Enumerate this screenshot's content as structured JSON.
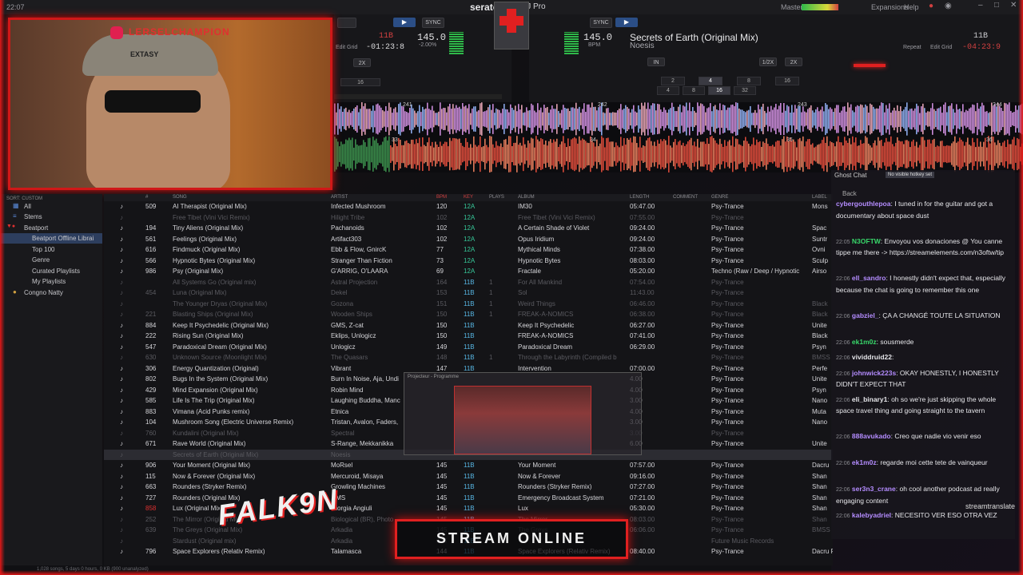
{
  "topbar": {
    "clock": "22:07",
    "app_name": "serato",
    "app_suffix": "DJ Pro",
    "master_label": "Master",
    "expansions": "Expansions",
    "help": "Help"
  },
  "deck_left": {
    "key": "11B",
    "bpm": "145.0",
    "pitch": "-2.00%",
    "time": "-01:23:8",
    "edit_grid": "Edit Grid",
    "sync": "SYNC",
    "pads_top": [
      "16"
    ],
    "pad_rows": [
      "2X"
    ]
  },
  "deck_right": {
    "title": "Secrets of Earth (Original Mix)",
    "artist": "Noesis",
    "bpm": "145.0",
    "bpm_label": "BPM",
    "key": "11B",
    "time": "-04:23:9",
    "repeat": "Repeat",
    "edit_grid": "Edit Grid",
    "sync": "SYNC",
    "loop_top": [
      "IN",
      "1/2X",
      "2X"
    ],
    "loop_row1": [
      "2",
      "4",
      "8",
      "16"
    ],
    "loop_row2": [
      "4",
      "8",
      "16",
      "32"
    ],
    "loop_right": "16"
  },
  "waveform": {
    "beat_markers": [
      "241",
      "242",
      "243",
      "244"
    ],
    "lower_markers": [
      "33",
      "34",
      "35",
      "36"
    ]
  },
  "webcam": {
    "ig_handle": "LERSELCHAMPION",
    "cap_text": "EXTASY"
  },
  "sidebar": {
    "header": "SORT: CUSTOM",
    "items": [
      {
        "label": "All"
      },
      {
        "label": "Stems"
      },
      {
        "label": "Beatport"
      },
      {
        "label": "Beatport Offline Librai"
      },
      {
        "label": "Top 100"
      },
      {
        "label": "Genre"
      },
      {
        "label": "Curated Playlists"
      },
      {
        "label": "My Playlists"
      },
      {
        "label": "Congno Natty"
      }
    ]
  },
  "table": {
    "headers": [
      "#",
      "SONG",
      "ARTIST",
      "BPM",
      "KEY",
      "PLAYS",
      "ALBUM",
      "LENGTH",
      "COMMENT",
      "GENRE",
      "LABEL"
    ],
    "rows": [
      {
        "n": "509",
        "song": "AI Therapist (Original Mix)",
        "artist": "Infected Mushroom",
        "bpm": "120",
        "key": "12A",
        "plays": "",
        "album": "IM30",
        "length": "05:47.00",
        "genre": "Psy-Trance",
        "label": "Mons",
        "dim": false
      },
      {
        "n": "",
        "song": "Free Tibet (Vini Vici Remix)",
        "artist": "Hilight Tribe",
        "bpm": "102",
        "key": "12A",
        "plays": "",
        "album": "Free Tibet (Vini Vici Remix)",
        "length": "07:55.00",
        "genre": "Psy-Trance",
        "label": "",
        "dim": true
      },
      {
        "n": "194",
        "song": "Tiny Aliens (Original Mix)",
        "artist": "Pachanoids",
        "bpm": "102",
        "key": "12A",
        "plays": "",
        "album": "A Certain Shade of Violet",
        "length": "09:24.00",
        "genre": "Psy-Trance",
        "label": "Spac",
        "dim": false
      },
      {
        "n": "561",
        "song": "Feelings (Original Mix)",
        "artist": "Artifact303",
        "bpm": "102",
        "key": "12A",
        "plays": "",
        "album": "Opus Iridium",
        "length": "09:24.00",
        "genre": "Psy-Trance",
        "label": "Suntr",
        "dim": false
      },
      {
        "n": "616",
        "song": "Findmuck (Original Mix)",
        "artist": "Ebb & Flow, GnircK",
        "bpm": "77",
        "key": "12A",
        "plays": "",
        "album": "Mythical Minds",
        "length": "07:38.00",
        "genre": "Psy-Trance",
        "label": "Ovni",
        "dim": false
      },
      {
        "n": "566",
        "song": "Hypnotic Bytes (Original Mix)",
        "artist": "Stranger Than Fiction",
        "bpm": "73",
        "key": "12A",
        "plays": "",
        "album": "Hypnotic Bytes",
        "length": "08:03.00",
        "genre": "Psy-Trance",
        "label": "Sculp",
        "dim": false
      },
      {
        "n": "986",
        "song": "Psy (Original Mix)",
        "artist": "G'ARRIG, O'LAARA",
        "bpm": "69",
        "key": "12A",
        "plays": "",
        "album": "Fractale",
        "length": "05:20.00",
        "genre": "Techno (Raw / Deep / Hypnotic",
        "label": "Airso",
        "dim": false
      },
      {
        "n": "",
        "song": "All Systems Go (Original mix)",
        "artist": "Astral Projection",
        "bpm": "164",
        "key": "11B",
        "plays": "1",
        "album": "For All Mankind",
        "length": "07:54.00",
        "genre": "Psy-Trance",
        "label": "",
        "dim": true
      },
      {
        "n": "454",
        "song": "Luna (Original Mix)",
        "artist": "Dekel",
        "bpm": "153",
        "key": "11B",
        "plays": "1",
        "album": "Sol",
        "length": "11:43.00",
        "genre": "Psy-Trance",
        "label": "",
        "dim": true
      },
      {
        "n": "",
        "song": "The Younger Dryas (Original Mix)",
        "artist": "Gozona",
        "bpm": "151",
        "key": "11B",
        "plays": "1",
        "album": "Weird Things",
        "length": "06:46.00",
        "genre": "Psy-Trance",
        "label": "Black",
        "dim": true
      },
      {
        "n": "221",
        "song": "Blasting Ships (Original Mix)",
        "artist": "Wooden Ships",
        "bpm": "150",
        "key": "11B",
        "plays": "1",
        "album": "FREAK-A-NOMICS",
        "length": "06:38.00",
        "genre": "Psy-Trance",
        "label": "Black",
        "dim": true
      },
      {
        "n": "884",
        "song": "Keep It Psychedelic (Original Mix)",
        "artist": "GMS, Z-cat",
        "bpm": "150",
        "key": "11B",
        "plays": "",
        "album": "Keep It Psychedelic",
        "length": "06:27.00",
        "genre": "Psy-Trance",
        "label": "Unite",
        "dim": false
      },
      {
        "n": "222",
        "song": "Rising Sun (Original Mix)",
        "artist": "Eklips, Unlogicz",
        "bpm": "150",
        "key": "11B",
        "plays": "",
        "album": "FREAK-A-NOMICS",
        "length": "07:41.00",
        "genre": "Psy-Trance",
        "label": "Black",
        "dim": false
      },
      {
        "n": "547",
        "song": "Paradoxical Dream (Original Mix)",
        "artist": "Unlogicz",
        "bpm": "149",
        "key": "11B",
        "plays": "",
        "album": "Paradoxical Dream",
        "length": "06:29.00",
        "genre": "Psy-Trance",
        "label": "Psyn",
        "dim": false
      },
      {
        "n": "630",
        "song": "Unknown Source (Moonlight Mix)",
        "artist": "The Quasars",
        "bpm": "148",
        "key": "11B",
        "plays": "1",
        "album": "Through the Labyrinth (Compiled b",
        "length": "",
        "genre": "Psy-Trance",
        "label": "BMSS",
        "dim": true
      },
      {
        "n": "306",
        "song": "Energy Quantization (Original)",
        "artist": "Vibrant",
        "bpm": "147",
        "key": "11B",
        "plays": "",
        "album": "Intervention",
        "length": "07:00.00",
        "genre": "Psy-Trance",
        "label": "Perfe",
        "dim": false
      },
      {
        "n": "802",
        "song": "Bugs In the System (Original Mix)",
        "artist": "Burn In Noise, Aja, Undi",
        "bpm": "",
        "key": "",
        "plays": "",
        "album": "",
        "length": "4.00",
        "genre": "Psy-Trance",
        "label": "Unite",
        "dim": false
      },
      {
        "n": "429",
        "song": "Mind Expansion (Original Mix)",
        "artist": "Robin Mind",
        "bpm": "",
        "key": "",
        "plays": "",
        "album": "",
        "length": "4.00",
        "genre": "Psy-Trance",
        "label": "Psyn",
        "dim": false
      },
      {
        "n": "585",
        "song": "Life Is The Trip (Original Mix)",
        "artist": "Laughing Buddha, Manc",
        "bpm": "",
        "key": "",
        "plays": "",
        "album": "",
        "length": "3.00",
        "genre": "Psy-Trance",
        "label": "Nano",
        "dim": false
      },
      {
        "n": "883",
        "song": "Vimana (Acid Punks remix)",
        "artist": "Etnica",
        "bpm": "",
        "key": "",
        "plays": "",
        "album": "",
        "length": "4.00",
        "genre": "Psy-Trance",
        "label": "Muta",
        "dim": false
      },
      {
        "n": "104",
        "song": "Mushroom Song (Electric Universe Remix)",
        "artist": "Tristan, Avalon, Faders,",
        "bpm": "",
        "key": "",
        "plays": "",
        "album": "",
        "length": "3.00",
        "genre": "Psy-Trance",
        "label": "Nano",
        "dim": false
      },
      {
        "n": "760",
        "song": "Kundalini (Original Mix)",
        "artist": "Spectral",
        "bpm": "",
        "key": "",
        "plays": "",
        "album": "",
        "length": "3.00",
        "genre": "Psy-Trance",
        "label": "",
        "dim": true
      },
      {
        "n": "671",
        "song": "Rave World (Original Mix)",
        "artist": "S-Range, Mekkanikka",
        "bpm": "",
        "key": "",
        "plays": "",
        "album": "",
        "length": "6.00",
        "genre": "Psy-Trance",
        "label": "Unite",
        "dim": false
      },
      {
        "n": "",
        "song": "Secrets of Earth (Original Mix)",
        "artist": "Noesis",
        "bpm": "",
        "key": "",
        "plays": "",
        "album": "",
        "length": "",
        "genre": "",
        "label": "",
        "dim": true,
        "sel": true
      },
      {
        "n": "906",
        "song": "Your Moment (Original Mix)",
        "artist": "MoRsel",
        "bpm": "145",
        "key": "11B",
        "plays": "",
        "album": "Your Moment",
        "length": "07:57.00",
        "genre": "Psy-Trance",
        "label": "Dacru",
        "dim": false
      },
      {
        "n": "115",
        "song": "Now & Forever (Original Mix)",
        "artist": "Mercuroid, Misaya",
        "bpm": "145",
        "key": "11B",
        "plays": "",
        "album": "Now & Forever",
        "length": "09:16.00",
        "genre": "Psy-Trance",
        "label": "Shan",
        "dim": false
      },
      {
        "n": "663",
        "song": "Rounders (Stryker Remix)",
        "artist": "Growling Machines",
        "bpm": "145",
        "key": "11B",
        "plays": "",
        "album": "Rounders (Stryker Remix)",
        "length": "07:27.00",
        "genre": "Psy-Trance",
        "label": "Shan",
        "dim": false
      },
      {
        "n": "727",
        "song": "Rounders (Original Mix)",
        "artist": "GMS",
        "bpm": "145",
        "key": "11B",
        "plays": "",
        "album": "Emergency Broadcast System",
        "length": "07:21.00",
        "genre": "Psy-Trance",
        "label": "Shan",
        "dim": false
      },
      {
        "n": "858",
        "song": "Lux (Original Mix)",
        "artist": "Giorgia Angiuli",
        "bpm": "145",
        "key": "11B",
        "plays": "",
        "album": "Lux",
        "length": "05:30.00",
        "genre": "Psy-Trance",
        "label": "Shan",
        "dim": false
      },
      {
        "n": "252",
        "song": "The Mirror (Original Mix)",
        "artist": "Biological (BR), Photo",
        "bpm": "145",
        "key": "11B",
        "plays": "",
        "album": "The Mirror",
        "length": "08:03.00",
        "genre": "Psy-Trance",
        "label": "Shan",
        "dim": true
      },
      {
        "n": "639",
        "song": "The Greys (Original Mix)",
        "artist": "Arkadia",
        "bpm": "145",
        "key": "11B",
        "plays": "",
        "album": "The Greys",
        "length": "06:06.00",
        "genre": "Psy-Trance",
        "label": "BMSS",
        "dim": true
      },
      {
        "n": "",
        "song": "Stardust (Original mix)",
        "artist": "Arkadia",
        "bpm": "145",
        "key": "11B",
        "plays": "",
        "album": "",
        "length": "",
        "genre": "Future Music Records",
        "label": "",
        "dim": true
      },
      {
        "n": "796",
        "song": "Space Explorers (Relativ Remix)",
        "artist": "Talamasca",
        "bpm": "144",
        "key": "11B",
        "plays": "",
        "album": "Space Explorers (Relativ Remix)",
        "length": "08:40.00",
        "genre": "Psy-Trance",
        "label": "Dacru Records",
        "dim": false
      }
    ]
  },
  "chat": {
    "title": "Ghost Chat",
    "badge": "No visible hotkey set",
    "back": "Back",
    "messages": [
      {
        "time": "",
        "user": "cybergouthlepoa",
        "color": "#b48cff",
        "text": "I tuned in for the guitar and got a documentary about space dust"
      },
      {
        "time": "22:05",
        "user": "N3OFTW",
        "color": "#38d86a",
        "text": "Envoyou vos donaciones @ You canne tippe me there -> https://streamelements.com/n3oftw/tip"
      },
      {
        "time": "22:06",
        "user": "ell_sandro",
        "color": "#b48cff",
        "text": "I honestly didn't expect that, especially because the chat is going to remember this one"
      },
      {
        "time": "22:06",
        "user": "gabziel_",
        "color": "#b48cff",
        "text": "ÇA A CHANGÉ TOUTE LA SITUATION"
      },
      {
        "time": "22:06",
        "user": "ek1m0z",
        "color": "#38d86a",
        "text": "sousmerde"
      },
      {
        "time": "22:06",
        "user": "vividdruid22",
        "color": "#e6e6ea",
        "text": ""
      },
      {
        "time": "22:06",
        "user": "johnwick223s",
        "color": "#b48cff",
        "text": "OKAY HONESTLY, I HONESTLY DIDN'T EXPECT THAT"
      },
      {
        "time": "22:06",
        "user": "eli_binary1",
        "color": "#e6e6ea",
        "text": "oh so we're just skipping the whole space travel thing and going straight to the tavern"
      },
      {
        "time": "22:06",
        "user": "888avukado",
        "color": "#b48cff",
        "text": "Creo que nadie vio venir eso"
      },
      {
        "time": "22:06",
        "user": "ek1m0z",
        "color": "#b48cff",
        "text": "regarde moi cette tete de vainqueur"
      },
      {
        "time": "22:06",
        "user": "ser3n3_crane",
        "color": "#b48cff",
        "text": "oh cool another podcast ad really engaging content"
      },
      {
        "time": "22:06",
        "user": "kalebyadriel",
        "color": "#b48cff",
        "text": "NECESITO VER ESO OTRA VEZ"
      }
    ],
    "watermark": "streamtranslate"
  },
  "overlay": {
    "stream_text": "STREAM ONLINE",
    "logo_text": "FALK9N",
    "pip_title": "Projecteur - Programme"
  },
  "status": {
    "text": "1,028 songs, 5 days 0 hours, 0 KB (900 unanalyzed)"
  },
  "colors": {
    "accent_red": "#e01818",
    "key_blue": "#58b8e6",
    "key_green": "#37c99a",
    "chat_purple": "#b48cff"
  }
}
